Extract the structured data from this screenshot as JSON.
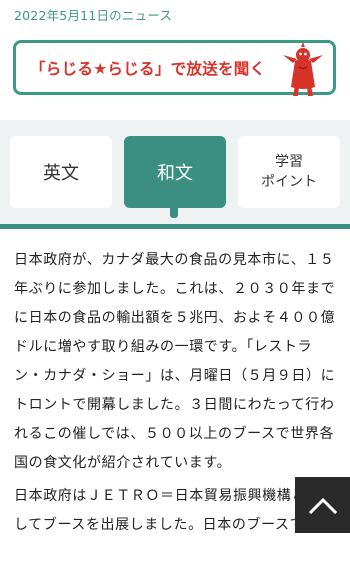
{
  "date": "2022年5月11日のニュース",
  "radio_banner": {
    "label": "「らじる★らじる」で放送を聞く",
    "text_color": "#d6332b",
    "border_color": "#3b9a86"
  },
  "tabs": [
    {
      "label": "英文",
      "selected": false
    },
    {
      "label": "和文",
      "selected": true
    },
    {
      "line1": "学習",
      "line2": "ポイント",
      "selected": false
    }
  ],
  "accent_color": "#3b8f80",
  "article": {
    "para1": "日本政府が、カナダ最大の食品の見本市に、１５年ぶりに参加しました。これは、２０３０年までに日本の食品の輸出額を５兆円、およそ４００億ドルに増やす取り組みの一環です。「レストラン・カナダ・ショー」は、月曜日（５月９日）にトロントで開幕しました。３日間にわたって行われるこの催しでは、５００以上のブースで世界各国の食文化が紹介されています。",
    "para2": "日本政府はＪＥＴＲＯ＝日本貿易振興機構と連携してブースを出展しました。日本のブースで"
  },
  "scroll_top": {
    "icon": "chevron-up-icon"
  }
}
